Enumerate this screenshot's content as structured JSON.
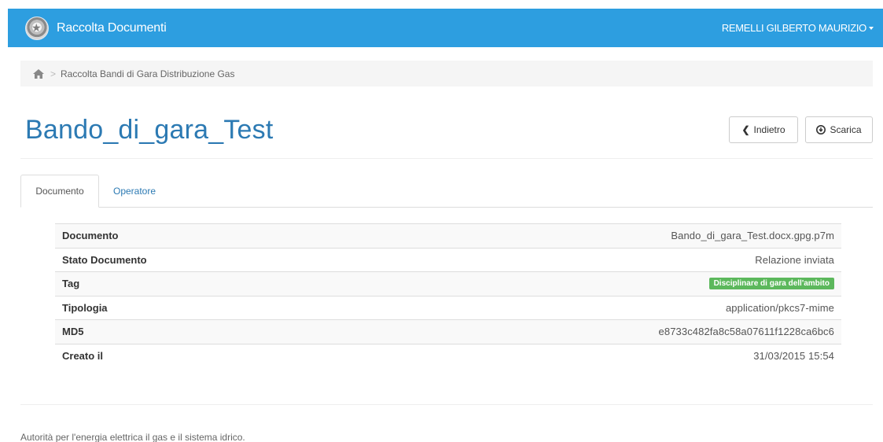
{
  "navbar": {
    "brand": "Raccolta Documenti",
    "user": "REMELLI GILBERTO MAURIZIO"
  },
  "breadcrumb": {
    "home_icon": "home-icon",
    "items": [
      "Raccolta Bandi di Gara Distribuzione Gas"
    ]
  },
  "page": {
    "title": "Bando_di_gara_Test",
    "back_label": "Indietro",
    "download_label": "Scarica"
  },
  "tabs": [
    {
      "label": "Documento",
      "active": true
    },
    {
      "label": "Operatore",
      "active": false
    }
  ],
  "details": [
    {
      "label": "Documento",
      "value": "Bando_di_gara_Test.docx.gpg.p7m"
    },
    {
      "label": "Stato Documento",
      "value": "Relazione inviata"
    },
    {
      "label": "Tag",
      "value": "Disciplinare di gara dell'ambito"
    },
    {
      "label": "Tipologia",
      "value": "application/pkcs7-mime"
    },
    {
      "label": "MD5",
      "value": "e8733c482fa8c58a07611f1228ca6bc6"
    },
    {
      "label": "Creato il",
      "value": "31/03/2015 15:54"
    }
  ],
  "footer": "Autorità per l'energia elettrica il gas e il sistema idrico.",
  "colors": {
    "navbar": "#2d9ee0",
    "title": "#2c7ab3",
    "tag": "#5cb85c"
  }
}
